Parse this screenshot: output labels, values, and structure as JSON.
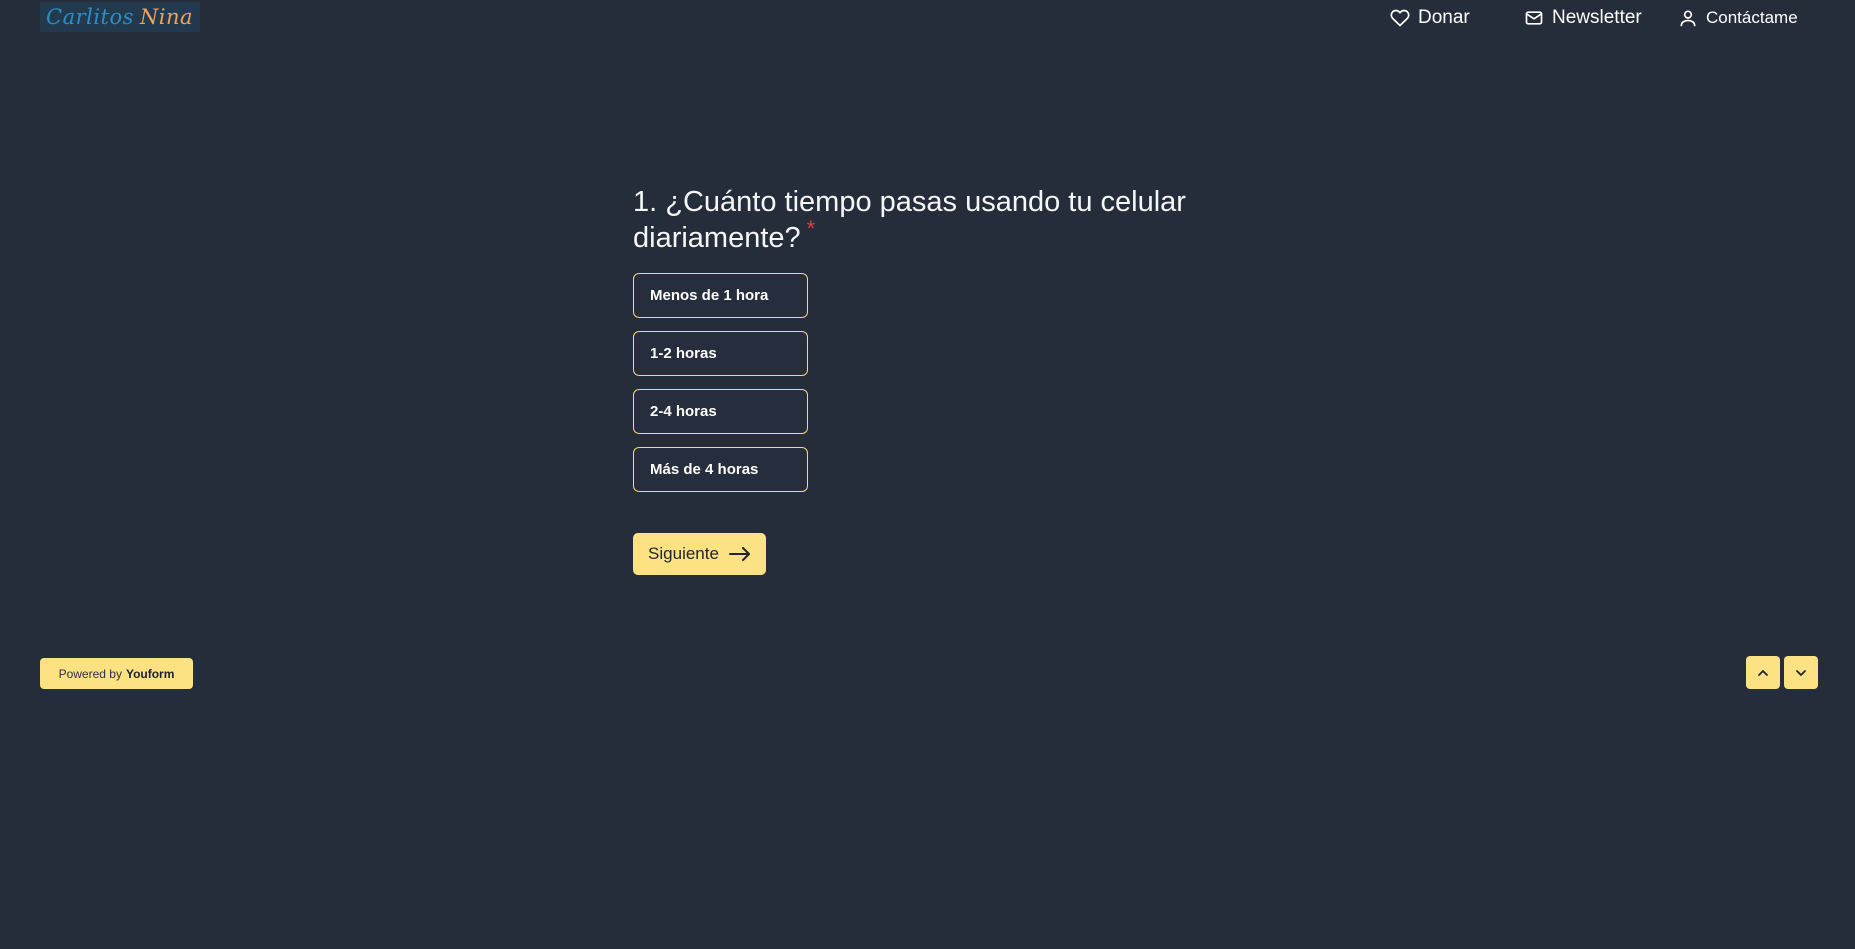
{
  "header": {
    "logo": {
      "first": "Carlitos",
      "last": "Nina"
    },
    "nav": {
      "donar": "Donar",
      "newsletter": "Newsletter",
      "contact": "Contáctame"
    }
  },
  "question": {
    "text": "1. ¿Cuánto tiempo pasas usando tu celular diariamente?",
    "required_mark": "*"
  },
  "options": [
    "Menos de 1 hora",
    "1-2 horas",
    "2-4 horas",
    "Más de 4 horas"
  ],
  "next_button": {
    "label": "Siguiente"
  },
  "footer": {
    "powered_by": "Powered by",
    "brand": "Youform"
  },
  "colors": {
    "background": "#252c3a",
    "accent": "#fde283",
    "option_border": "#f7d97a",
    "required": "#e53e3e"
  }
}
